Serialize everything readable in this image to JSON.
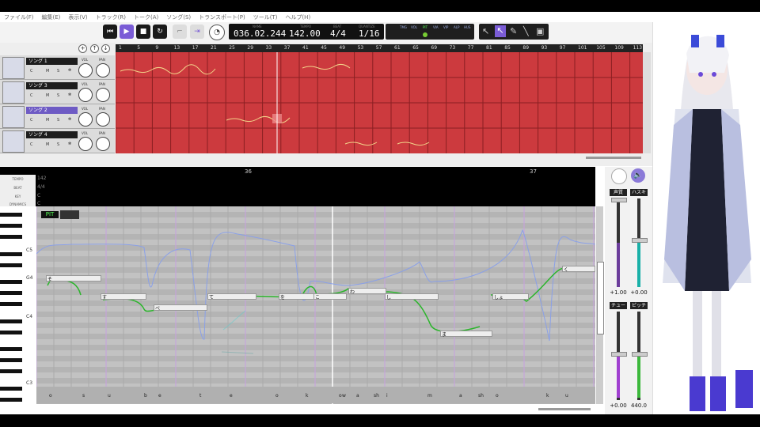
{
  "menu": [
    "ファイル(F)",
    "編集(E)",
    "表示(V)",
    "トラック(R)",
    "トーク(A)",
    "ソング(S)",
    "トランスポート(P)",
    "ツール(T)",
    "ヘルプ(H)"
  ],
  "transport": {
    "time_caption": "NAME",
    "time": "036.02.244",
    "tempo_caption": "TEMPO",
    "tempo": "142.00",
    "beat_caption": "BEAT",
    "beat": "4/4",
    "quantize_caption": "QUANTIZE",
    "quantize": "1/16",
    "params": [
      "TMG",
      "VOL",
      "PIT",
      "VIA",
      "VIP",
      "ALP",
      "HUS"
    ]
  },
  "tracks": [
    {
      "name": "ソング 1",
      "selected": false
    },
    {
      "name": "ソング 3",
      "selected": false
    },
    {
      "name": "ソング 2",
      "selected": true
    },
    {
      "name": "ソング 4",
      "selected": false
    }
  ],
  "track_labels": {
    "vol": "VOL",
    "pan": "PAN",
    "c": "C",
    "m": "M",
    "s": "S"
  },
  "ruler": [
    "1",
    "5",
    "9",
    "13",
    "17",
    "21",
    "25",
    "29",
    "33",
    "37",
    "41",
    "45",
    "49",
    "53",
    "57",
    "61",
    "65",
    "69",
    "73",
    "77",
    "81",
    "85",
    "89",
    "93",
    "97",
    "101",
    "105",
    "109",
    "113"
  ],
  "piano_roll": {
    "header_rows": [
      "TEMPO",
      "BEAT",
      "KEY",
      "DYNAMICS"
    ],
    "header_values": [
      "142",
      "4/4",
      "C",
      "C"
    ],
    "measures": [
      "36",
      "37"
    ],
    "mode_badge": "PIT",
    "key_labels": [
      "C5",
      "G4",
      "C4",
      "C3"
    ],
    "notes": [
      {
        "lyric": "そ"
      },
      {
        "lyric": "す"
      },
      {
        "lyric": "べ"
      },
      {
        "lyric": "て"
      },
      {
        "lyric": "を"
      },
      {
        "lyric": "こ"
      },
      {
        "lyric": "わ"
      },
      {
        "lyric": "し"
      },
      {
        "lyric": "ま"
      },
      {
        "lyric": "しょ"
      },
      {
        "lyric": "く"
      }
    ],
    "phonemes": [
      "o",
      "s",
      "u",
      "b",
      "e",
      "t",
      "e",
      "o",
      "k",
      "o",
      "w",
      "a",
      "sh",
      "i",
      "m",
      "a",
      "sh",
      "o",
      "k",
      "u"
    ]
  },
  "mixer": {
    "voice_label": "声質",
    "voice_value": "+1.00",
    "husky_label": "ハスキー",
    "husky_value": "+0.00",
    "tune_label": "チューン",
    "tune_value": "+0.00",
    "pitch_label": "ピッチ",
    "pitch_value": "440.0"
  },
  "colors": {
    "song_grid": "#cc3a3e",
    "accent": "#7a5cd6",
    "pitch_line": "#2bb52b",
    "pitch_ref": "#8aa0e8"
  }
}
